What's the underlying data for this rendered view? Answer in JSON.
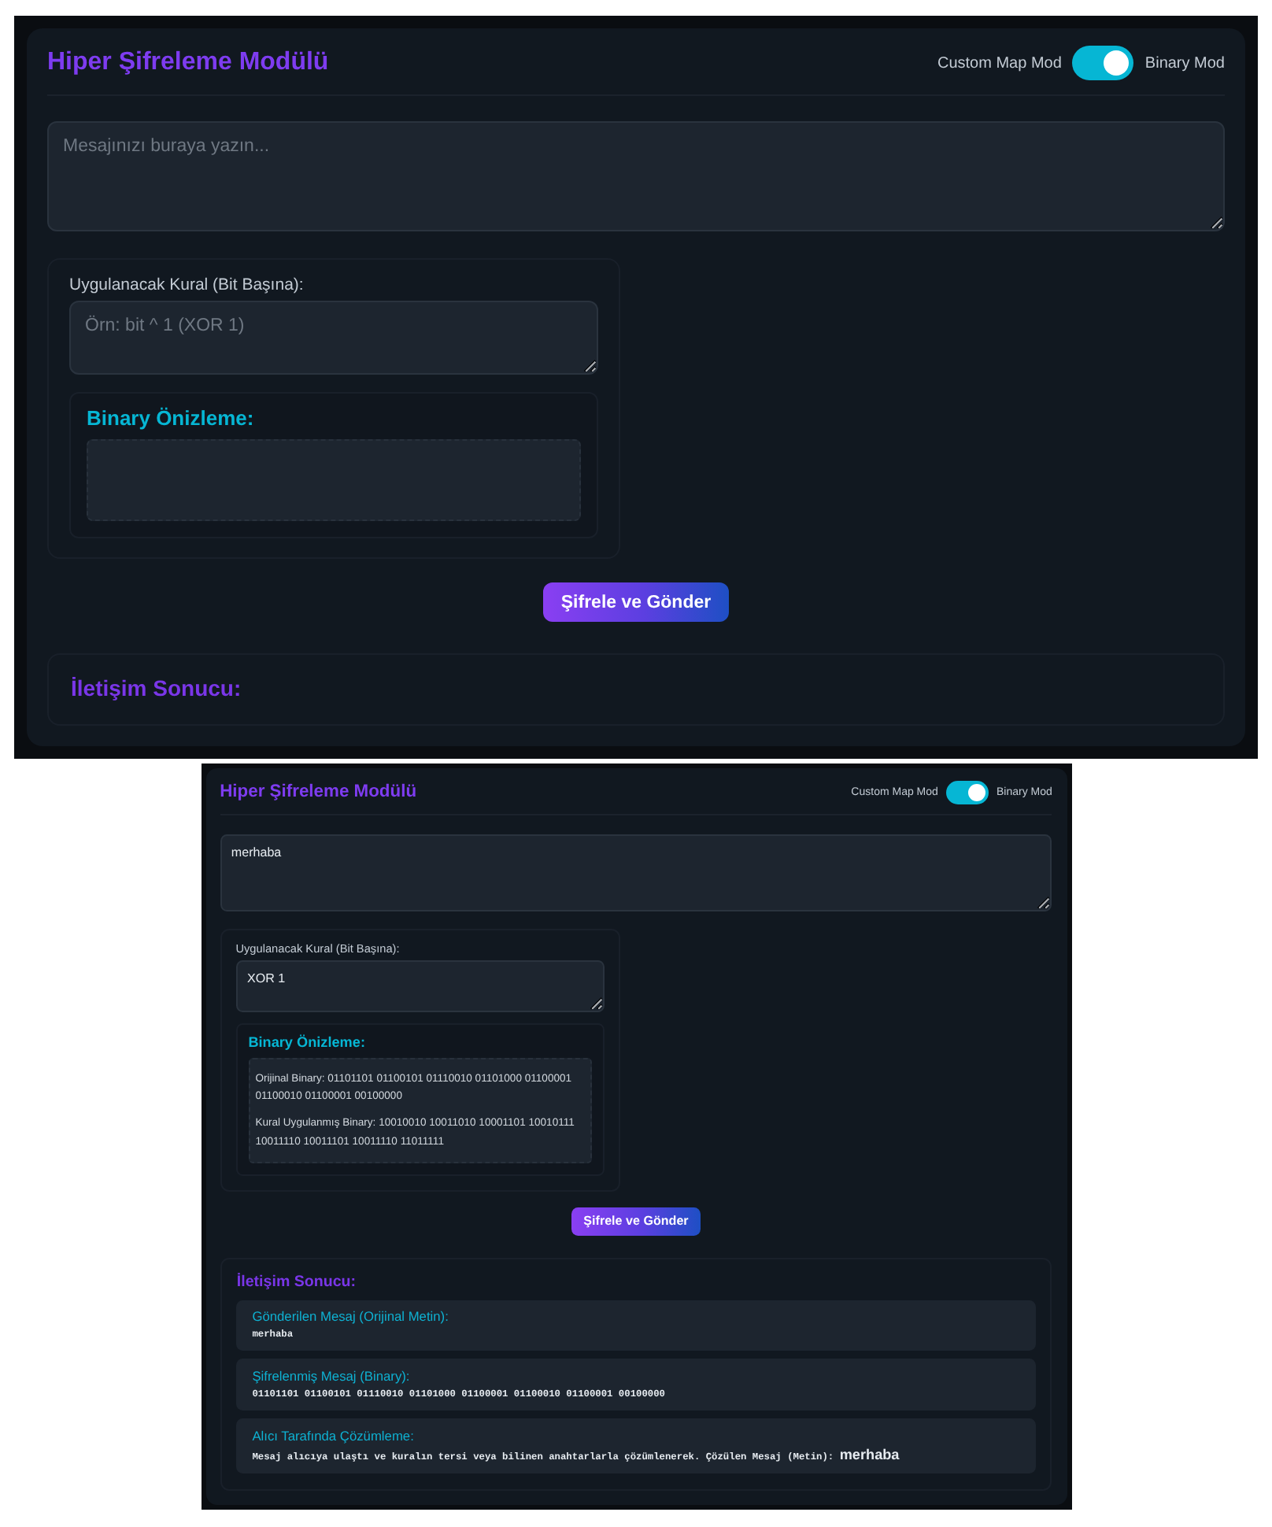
{
  "screens": [
    {
      "title": "Hiper Şifreleme Modülü",
      "mode_toggle": {
        "left_label": "Custom Map Mod",
        "right_label": "Binary Mod",
        "on": true
      },
      "message": {
        "placeholder": "Mesajınızı buraya yazın..."
      },
      "rule": {
        "label": "Uygulanacak Kural (Bit Başına):",
        "placeholder": "Örn: bit ^ 1 (XOR 1)"
      },
      "preview": {
        "title": "Binary Önizleme:"
      },
      "submit_button": "Şifrele ve Gönder",
      "result": {
        "title": "İletişim Sonucu:"
      }
    },
    {
      "title": "Hiper Şifreleme Modülü",
      "mode_toggle": {
        "left_label": "Custom Map Mod",
        "right_label": "Binary Mod",
        "on": true
      },
      "message": {
        "value": "merhaba"
      },
      "rule": {
        "label": "Uygulanacak Kural (Bit Başına):",
        "value": "XOR 1"
      },
      "preview": {
        "title": "Binary Önizleme:",
        "lines": [
          "Orijinal Binary: 01101101 01100101 01110010 01101000 01100001 01100010 01100001 00100000",
          "Kural Uygulanmış Binary: 10010010 10011010 10001101 10010111 10011110 10011101 10011110 11011111"
        ]
      },
      "submit_button": "Şifrele ve Gönder",
      "result": {
        "title": "İletişim Sonucu:",
        "blocks": [
          {
            "heading": "Gönderilen Mesaj (Orijinal Metin):",
            "text": "merhaba"
          },
          {
            "heading": "Şifrelenmiş Mesaj (Binary):",
            "text": "01101101 01100101 01110010 01101000 01100001 01100010 01100001 00100000"
          },
          {
            "heading": "Alıcı Tarafında Çözümleme:",
            "text": "Mesaj alıcıya ulaştı ve kuralın tersi veya bilinen anahtarlarla çözümlenerek. Çözülen Mesaj (Metin): **merhaba**"
          }
        ]
      }
    }
  ]
}
